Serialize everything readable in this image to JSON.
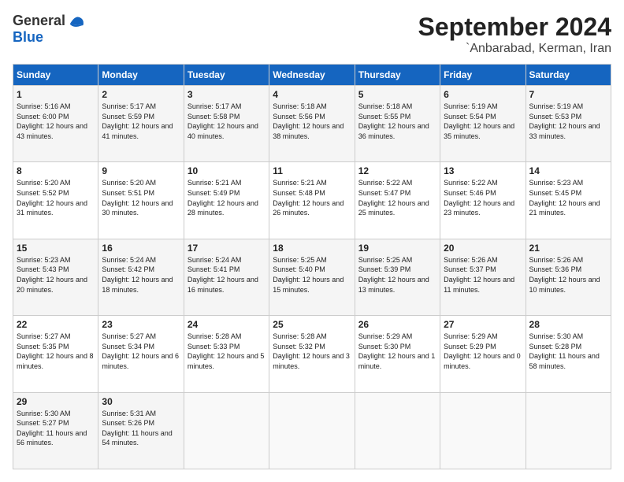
{
  "logo": {
    "general": "General",
    "blue": "Blue"
  },
  "header": {
    "month": "September 2024",
    "location": "`Anbarabad, Kerman, Iran"
  },
  "weekdays": [
    "Sunday",
    "Monday",
    "Tuesday",
    "Wednesday",
    "Thursday",
    "Friday",
    "Saturday"
  ],
  "weeks": [
    [
      {
        "day": "1",
        "sunrise": "5:16 AM",
        "sunset": "6:00 PM",
        "daylight": "12 hours and 43 minutes"
      },
      {
        "day": "2",
        "sunrise": "5:17 AM",
        "sunset": "5:59 PM",
        "daylight": "12 hours and 41 minutes"
      },
      {
        "day": "3",
        "sunrise": "5:17 AM",
        "sunset": "5:58 PM",
        "daylight": "12 hours and 40 minutes"
      },
      {
        "day": "4",
        "sunrise": "5:18 AM",
        "sunset": "5:56 PM",
        "daylight": "12 hours and 38 minutes"
      },
      {
        "day": "5",
        "sunrise": "5:18 AM",
        "sunset": "5:55 PM",
        "daylight": "12 hours and 36 minutes"
      },
      {
        "day": "6",
        "sunrise": "5:19 AM",
        "sunset": "5:54 PM",
        "daylight": "12 hours and 35 minutes"
      },
      {
        "day": "7",
        "sunrise": "5:19 AM",
        "sunset": "5:53 PM",
        "daylight": "12 hours and 33 minutes"
      }
    ],
    [
      {
        "day": "8",
        "sunrise": "5:20 AM",
        "sunset": "5:52 PM",
        "daylight": "12 hours and 31 minutes"
      },
      {
        "day": "9",
        "sunrise": "5:20 AM",
        "sunset": "5:51 PM",
        "daylight": "12 hours and 30 minutes"
      },
      {
        "day": "10",
        "sunrise": "5:21 AM",
        "sunset": "5:49 PM",
        "daylight": "12 hours and 28 minutes"
      },
      {
        "day": "11",
        "sunrise": "5:21 AM",
        "sunset": "5:48 PM",
        "daylight": "12 hours and 26 minutes"
      },
      {
        "day": "12",
        "sunrise": "5:22 AM",
        "sunset": "5:47 PM",
        "daylight": "12 hours and 25 minutes"
      },
      {
        "day": "13",
        "sunrise": "5:22 AM",
        "sunset": "5:46 PM",
        "daylight": "12 hours and 23 minutes"
      },
      {
        "day": "14",
        "sunrise": "5:23 AM",
        "sunset": "5:45 PM",
        "daylight": "12 hours and 21 minutes"
      }
    ],
    [
      {
        "day": "15",
        "sunrise": "5:23 AM",
        "sunset": "5:43 PM",
        "daylight": "12 hours and 20 minutes"
      },
      {
        "day": "16",
        "sunrise": "5:24 AM",
        "sunset": "5:42 PM",
        "daylight": "12 hours and 18 minutes"
      },
      {
        "day": "17",
        "sunrise": "5:24 AM",
        "sunset": "5:41 PM",
        "daylight": "12 hours and 16 minutes"
      },
      {
        "day": "18",
        "sunrise": "5:25 AM",
        "sunset": "5:40 PM",
        "daylight": "12 hours and 15 minutes"
      },
      {
        "day": "19",
        "sunrise": "5:25 AM",
        "sunset": "5:39 PM",
        "daylight": "12 hours and 13 minutes"
      },
      {
        "day": "20",
        "sunrise": "5:26 AM",
        "sunset": "5:37 PM",
        "daylight": "12 hours and 11 minutes"
      },
      {
        "day": "21",
        "sunrise": "5:26 AM",
        "sunset": "5:36 PM",
        "daylight": "12 hours and 10 minutes"
      }
    ],
    [
      {
        "day": "22",
        "sunrise": "5:27 AM",
        "sunset": "5:35 PM",
        "daylight": "12 hours and 8 minutes"
      },
      {
        "day": "23",
        "sunrise": "5:27 AM",
        "sunset": "5:34 PM",
        "daylight": "12 hours and 6 minutes"
      },
      {
        "day": "24",
        "sunrise": "5:28 AM",
        "sunset": "5:33 PM",
        "daylight": "12 hours and 5 minutes"
      },
      {
        "day": "25",
        "sunrise": "5:28 AM",
        "sunset": "5:32 PM",
        "daylight": "12 hours and 3 minutes"
      },
      {
        "day": "26",
        "sunrise": "5:29 AM",
        "sunset": "5:30 PM",
        "daylight": "12 hours and 1 minute"
      },
      {
        "day": "27",
        "sunrise": "5:29 AM",
        "sunset": "5:29 PM",
        "daylight": "12 hours and 0 minutes"
      },
      {
        "day": "28",
        "sunrise": "5:30 AM",
        "sunset": "5:28 PM",
        "daylight": "11 hours and 58 minutes"
      }
    ],
    [
      {
        "day": "29",
        "sunrise": "5:30 AM",
        "sunset": "5:27 PM",
        "daylight": "11 hours and 56 minutes"
      },
      {
        "day": "30",
        "sunrise": "5:31 AM",
        "sunset": "5:26 PM",
        "daylight": "11 hours and 54 minutes"
      },
      null,
      null,
      null,
      null,
      null
    ]
  ]
}
